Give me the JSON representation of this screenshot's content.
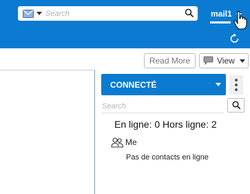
{
  "colors": {
    "accent": "#0a7bd0",
    "text": "#222222"
  },
  "header": {
    "search_placeholder": "Search",
    "account_label": "mail1",
    "icons": [
      "envelope-icon",
      "chevron-down-icon",
      "search-icon",
      "hand-pointer-icon",
      "refresh-icon"
    ]
  },
  "toolbar": {
    "read_more_label": "Read More",
    "view_label": "View"
  },
  "contacts": {
    "status_label": "CONNECTÉ",
    "search_placeholder": "Search",
    "online_summary": "En ligne: 0 Hors ligne: 2",
    "group_label": "Me",
    "empty_message": "Pas de contacts en ligne"
  }
}
